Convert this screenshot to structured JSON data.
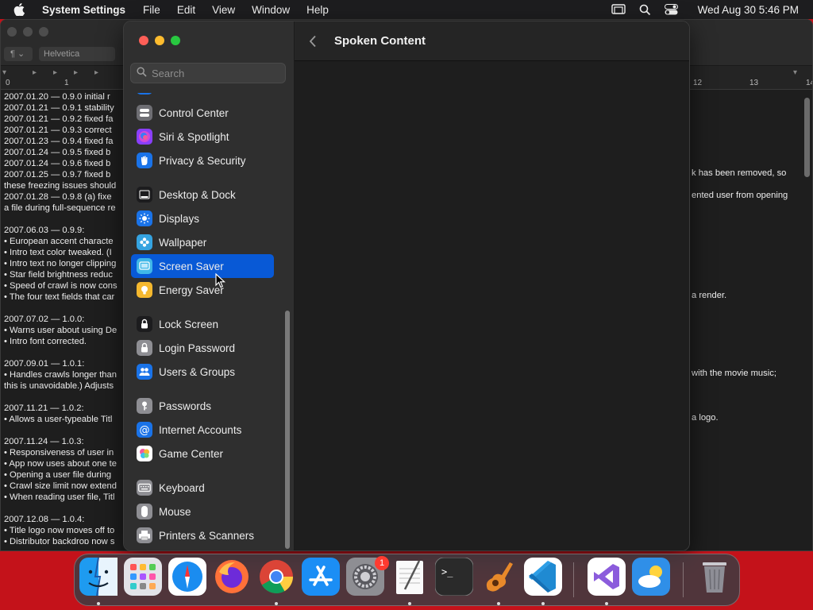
{
  "menubar": {
    "app_name": "System Settings",
    "items": [
      "File",
      "Edit",
      "View",
      "Window",
      "Help"
    ],
    "clock": "Wed Aug 30  5:46 PM"
  },
  "document": {
    "paragraph_style": "¶",
    "font": "Helvetica",
    "ruler_left": [
      "0",
      "1"
    ],
    "ruler_right": [
      "12",
      "13",
      "14"
    ],
    "left_lines": [
      "2007.01.20 — 0.9.0  initial r",
      "2007.01.21 — 0.9.1  stability",
      "2007.01.21 — 0.9.2  fixed fa",
      "2007.01.21 — 0.9.3  correct",
      "2007.01.23 — 0.9.4  fixed fa",
      "2007.01.24 — 0.9.5  fixed b",
      "2007.01.24 — 0.9.6  fixed b",
      "2007.01.25 — 0.9.7  fixed b",
      "these freezing issues should",
      "2007.01.28 — 0.9.8  (a) fixe",
      "a file during full-sequence re",
      "",
      "2007.06.03 — 0.9.9:",
      "• European accent characte",
      "• Intro text color tweaked.  (I",
      "• Intro text no longer clipping",
      "• Star field brightness reduc",
      "• Speed of crawl is now cons",
      "• The four text fields that car",
      "",
      "2007.07.02 — 1.0.0:",
      "• Warns user about using De",
      "• Intro font corrected.",
      "",
      "2007.09.01 — 1.0.1:",
      "• Handles crawls longer than",
      "this is unavoidable.)  Adjusts",
      "",
      "2007.11.21 — 1.0.2:",
      "• Allows a user-typeable Titl",
      "",
      "2007.11.24 — 1.0.3:",
      "• Responsiveness of user in",
      "• App now uses about one te",
      "• Opening a user file during",
      "• Crawl size limit now extend",
      "• When reading user file, Titl",
      "",
      "2007.12.08 — 1.0.4:",
      "• Title logo now moves off to",
      "• Distributor backdrop now s"
    ],
    "right_lines": [
      "k has been removed, so",
      "ented user from opening",
      "a render.",
      "with the movie music;",
      "a logo."
    ]
  },
  "settings": {
    "search_placeholder": "Search",
    "header_title": "Spoken Content",
    "sidebar": [
      {
        "label": "Control Center",
        "icon": "control-center-icon",
        "color": "#6e6e73"
      },
      {
        "label": "Siri & Spotlight",
        "icon": "siri-icon",
        "color": "#8a3ffc"
      },
      {
        "label": "Privacy & Security",
        "icon": "hand-icon",
        "color": "#1a73e8"
      },
      {
        "label": "Desktop & Dock",
        "icon": "dock-icon",
        "color": "#1c1c1e"
      },
      {
        "label": "Displays",
        "icon": "sun-icon",
        "color": "#1a73e8"
      },
      {
        "label": "Wallpaper",
        "icon": "flower-icon",
        "color": "#35a3e0"
      },
      {
        "label": "Screen Saver",
        "icon": "screen-saver-icon",
        "color": "#3fb7e8"
      },
      {
        "label": "Energy Saver",
        "icon": "lightbulb-icon",
        "color": "#f5b82e"
      },
      {
        "label": "Lock Screen",
        "icon": "lock-icon",
        "color": "#1c1c1e"
      },
      {
        "label": "Login Password",
        "icon": "lock-icon",
        "color": "#8e8e93"
      },
      {
        "label": "Users & Groups",
        "icon": "users-icon",
        "color": "#1a73e8"
      },
      {
        "label": "Passwords",
        "icon": "key-icon",
        "color": "#8e8e93"
      },
      {
        "label": "Internet Accounts",
        "icon": "at-icon",
        "color": "#1a73e8"
      },
      {
        "label": "Game Center",
        "icon": "game-center-icon",
        "color": "#ffffff"
      },
      {
        "label": "Keyboard",
        "icon": "keyboard-icon",
        "color": "#8e8e93"
      },
      {
        "label": "Mouse",
        "icon": "mouse-icon",
        "color": "#8e8e93"
      },
      {
        "label": "Printers & Scanners",
        "icon": "printer-icon",
        "color": "#8e8e93"
      }
    ],
    "selected": "Screen Saver"
  },
  "dock": {
    "apps": [
      {
        "name": "Finder",
        "icon": "finder-icon"
      },
      {
        "name": "Launchpad",
        "icon": "launchpad-icon"
      },
      {
        "name": "Safari",
        "icon": "safari-icon"
      },
      {
        "name": "Firefox",
        "icon": "firefox-icon"
      },
      {
        "name": "Chrome",
        "icon": "chrome-icon"
      },
      {
        "name": "App Store",
        "icon": "app-store-icon"
      },
      {
        "name": "System Settings",
        "icon": "system-settings-icon",
        "badge": "1"
      },
      {
        "name": "TextEdit",
        "icon": "textedit-icon"
      },
      {
        "name": "Terminal",
        "icon": "terminal-icon"
      },
      {
        "name": "GarageBand",
        "icon": "garageband-icon"
      },
      {
        "name": "Visual Studio Code",
        "icon": "vscode-icon"
      },
      {
        "name": "Visual Studio",
        "icon": "visual-studio-icon"
      },
      {
        "name": "Weather",
        "icon": "weather-icon"
      },
      {
        "name": "Trash",
        "icon": "trash-icon"
      }
    ]
  }
}
